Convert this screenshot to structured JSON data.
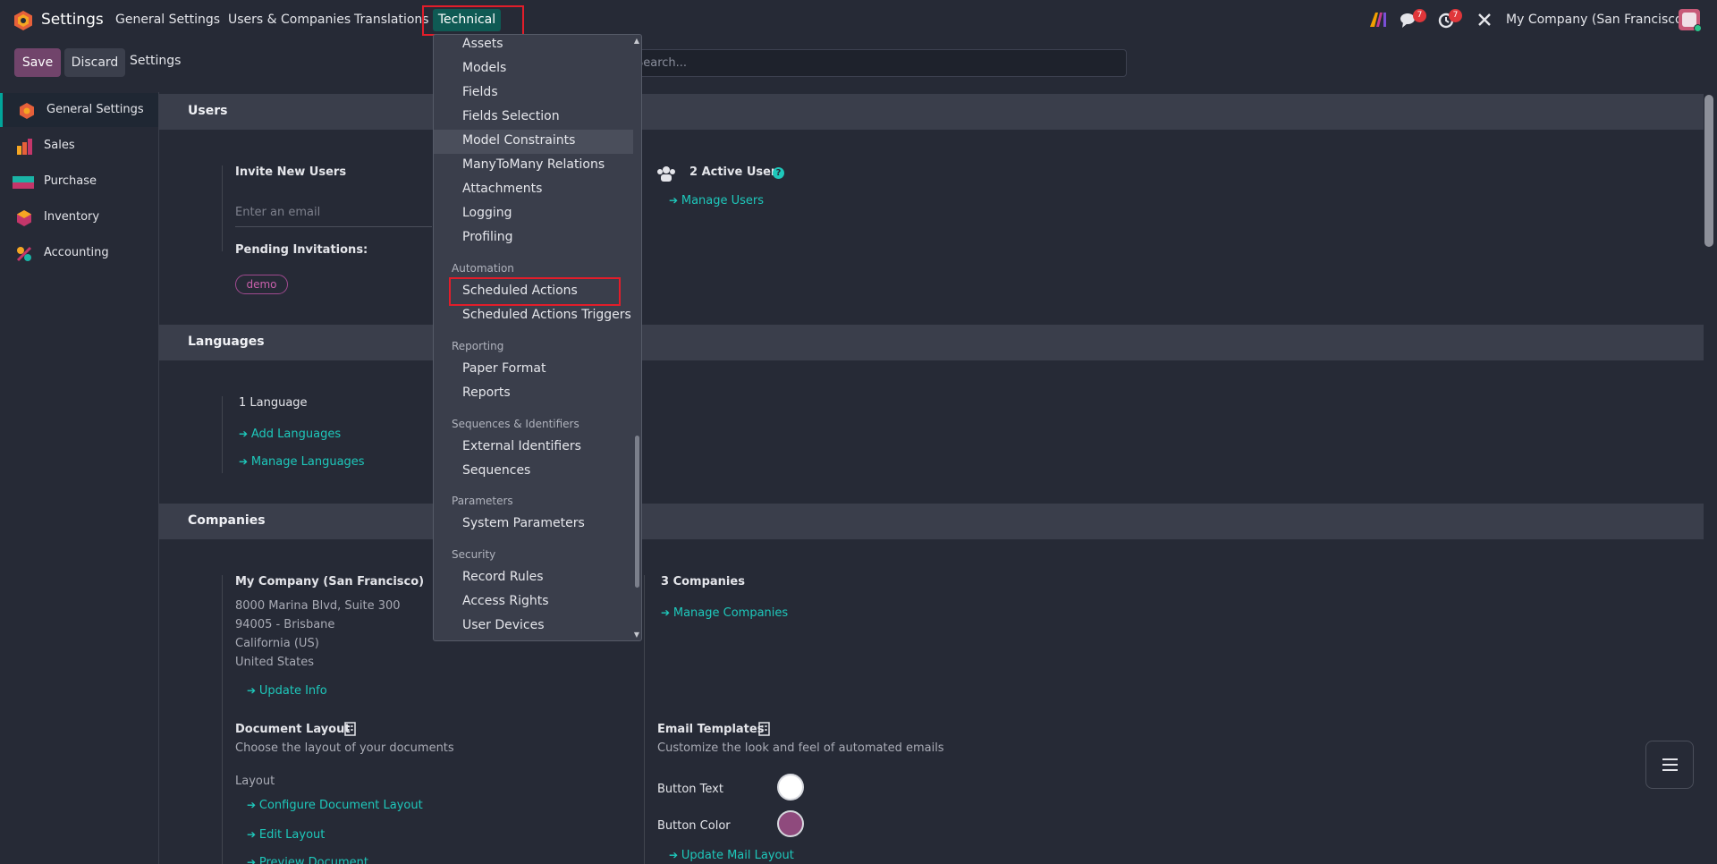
{
  "navbar": {
    "app_title": "Settings",
    "menu": [
      "General Settings",
      "Users & Companies",
      "Translations",
      "Technical"
    ],
    "company": "My Company (San Francisco)",
    "messages_badge": "7",
    "activities_badge": "7"
  },
  "control_panel": {
    "save_label": "Save",
    "discard_label": "Discard",
    "breadcrumb": "Settings",
    "search_placeholder": "Search..."
  },
  "sidebar": {
    "items": [
      {
        "label": "General Settings",
        "icon": "settings-app-icon",
        "active": true
      },
      {
        "label": "Sales",
        "icon": "sales-app-icon"
      },
      {
        "label": "Purchase",
        "icon": "purchase-app-icon"
      },
      {
        "label": "Inventory",
        "icon": "inventory-app-icon"
      },
      {
        "label": "Accounting",
        "icon": "accounting-app-icon"
      }
    ]
  },
  "users_section": {
    "title": "Users",
    "invite_label": "Invite New Users",
    "email_placeholder": "Enter an email",
    "pending_label": "Pending Invitations:",
    "pending_tag": "demo",
    "active_users": "2 Active Users",
    "manage_users": "Manage Users"
  },
  "languages_section": {
    "title": "Languages",
    "count": "1 Language",
    "add_languages": "Add Languages",
    "manage_languages": "Manage Languages"
  },
  "companies_section": {
    "title": "Companies",
    "company_name": "My Company (San Francisco)",
    "address": [
      "8000 Marina Blvd, Suite 300",
      "94005 - Brisbane",
      "California (US)",
      "United States"
    ],
    "update_info": "Update Info",
    "companies_count": "3 Companies",
    "manage_companies": "Manage Companies",
    "doc_layout_title": "Document Layout",
    "doc_layout_desc": "Choose the layout of your documents",
    "layout_label": "Layout",
    "configure_layout": "Configure Document Layout",
    "edit_layout": "Edit Layout",
    "preview_document": "Preview Document",
    "email_templates_title": "Email Templates",
    "email_templates_desc": "Customize the look and feel of automated emails",
    "button_text_label": "Button Text",
    "button_color_label": "Button Color",
    "update_mail_layout": "Update Mail Layout",
    "colors": {
      "button_text": "#ffffff",
      "button_color": "#8f4a7d"
    }
  },
  "technical_menu": {
    "items_top": [
      "Assets",
      "Models",
      "Fields",
      "Fields Selection",
      "Model Constraints",
      "ManyToMany Relations",
      "Attachments",
      "Logging",
      "Profiling"
    ],
    "automation_header": "Automation",
    "automation_items": [
      "Scheduled Actions",
      "Scheduled Actions Triggers"
    ],
    "reporting_header": "Reporting",
    "reporting_items": [
      "Paper Format",
      "Reports"
    ],
    "sequences_header": "Sequences & Identifiers",
    "sequences_items": [
      "External Identifiers",
      "Sequences"
    ],
    "parameters_header": "Parameters",
    "parameters_items": [
      "System Parameters"
    ],
    "security_header": "Security",
    "security_items": [
      "Record Rules",
      "Access Rights",
      "User Devices"
    ]
  },
  "colors": {
    "accent": "#1ec8bb",
    "primary": "#71446b",
    "highlight_border": "#e21d2a",
    "background": "#262a36"
  }
}
